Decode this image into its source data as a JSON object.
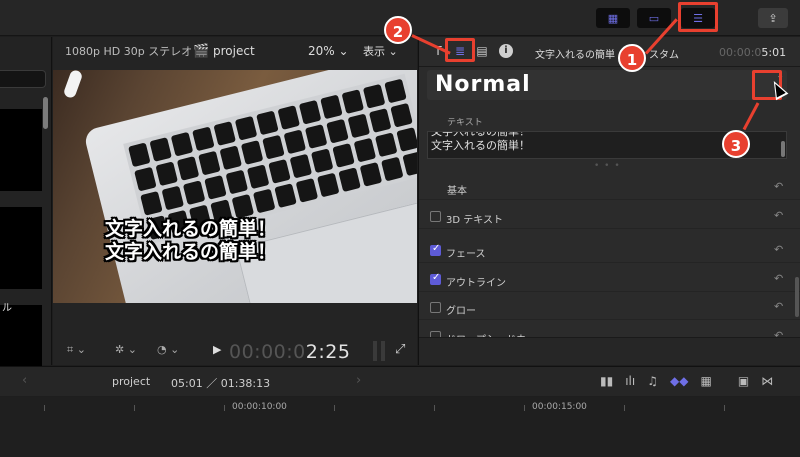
{
  "toolbar": {
    "btn_browser_icon": "▦",
    "btn_timeline_icon": "▭",
    "btn_inspector_icon": "☰",
    "btn_share_icon": "⇪"
  },
  "viewer": {
    "format": "1080p HD 30p ステレオ",
    "project_label": "project",
    "zoom": "20%",
    "view_menu": "表示",
    "caption_line1": "文字入れるの簡単！",
    "caption_line2": "文字入れるの簡単！",
    "timecode_dim": "00:00:0",
    "timecode_bright": "2:25"
  },
  "browser": {
    "partial_label": "ル"
  },
  "inspector": {
    "title": "文字入れるの簡単",
    "title_tail": "スタム",
    "duration_dim": "00:00:0",
    "duration_bright": "5:01",
    "preset": "Normal",
    "text_section_label": "テキスト",
    "text_line1": "文字入れるの簡単！",
    "text_line2": "文字入れるの簡単！",
    "basic_label": "基本",
    "rows": [
      {
        "label": "3D テキスト",
        "checked": false
      },
      {
        "label": "フェース",
        "checked": true
      },
      {
        "label": "アウトライン",
        "checked": true
      },
      {
        "label": "グロー",
        "checked": false
      },
      {
        "label": "ドロップシャドウ",
        "checked": false
      }
    ]
  },
  "timeline": {
    "project": "project",
    "time": "05:01 ／ 01:38:13",
    "tick1": "00:00:10:00",
    "tick2": "00:00:15:00"
  },
  "callouts": {
    "one": "1",
    "two": "2",
    "three": "3"
  },
  "colors": {
    "accent": "#5e5bd7",
    "callout": "#e8402f"
  }
}
